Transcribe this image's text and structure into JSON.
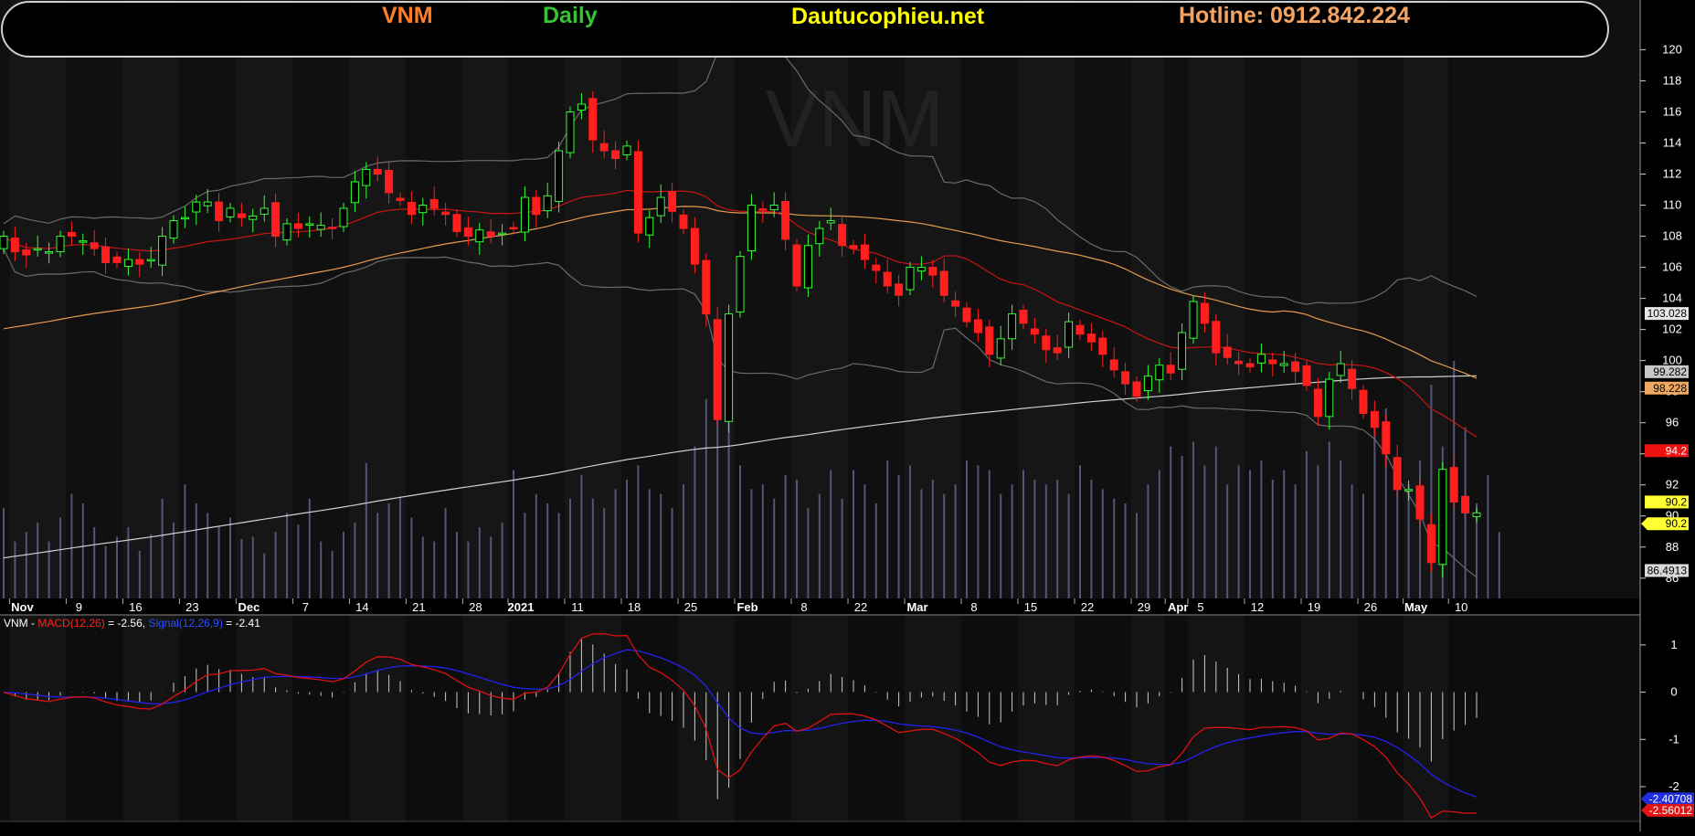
{
  "header": {
    "symbol": "VNM",
    "interval": "Daily",
    "site": "Dautucophieu.net",
    "hotline": "Hotline: 0912.842.224",
    "colors": {
      "symbol": "#ff7f27",
      "interval": "#34c534",
      "site": "#ffff00",
      "hotline": "#f4a460"
    }
  },
  "watermark": "VNM",
  "chart_data": [
    {
      "type": "candlestick",
      "title": "VNM",
      "ylim": [
        84.4,
        121.2
      ],
      "yticks": [
        86,
        88,
        90,
        92,
        94,
        96,
        98,
        100,
        102,
        104,
        106,
        108,
        110,
        112,
        114,
        116,
        118,
        120
      ],
      "date_labels": [
        {
          "i": 1,
          "label": "Nov",
          "major": true
        },
        {
          "i": 6,
          "label": "9",
          "major": false
        },
        {
          "i": 11,
          "label": "16",
          "major": false
        },
        {
          "i": 16,
          "label": "23",
          "major": false
        },
        {
          "i": 21,
          "label": "Dec",
          "major": true
        },
        {
          "i": 26,
          "label": "7",
          "major": false
        },
        {
          "i": 31,
          "label": "14",
          "major": false
        },
        {
          "i": 36,
          "label": "21",
          "major": false
        },
        {
          "i": 41,
          "label": "28",
          "major": false
        },
        {
          "i": 45,
          "label": "2021",
          "major": true
        },
        {
          "i": 50,
          "label": "11",
          "major": false
        },
        {
          "i": 55,
          "label": "18",
          "major": false
        },
        {
          "i": 60,
          "label": "25",
          "major": false
        },
        {
          "i": 65,
          "label": "Feb",
          "major": true
        },
        {
          "i": 70,
          "label": "8",
          "major": false
        },
        {
          "i": 75,
          "label": "22",
          "major": false
        },
        {
          "i": 80,
          "label": "Mar",
          "major": true
        },
        {
          "i": 85,
          "label": "8",
          "major": false
        },
        {
          "i": 90,
          "label": "15",
          "major": false
        },
        {
          "i": 95,
          "label": "22",
          "major": false
        },
        {
          "i": 100,
          "label": "29",
          "major": false
        },
        {
          "i": 103,
          "label": "Apr",
          "major": true
        },
        {
          "i": 105,
          "label": "5",
          "major": false
        },
        {
          "i": 110,
          "label": "12",
          "major": false
        },
        {
          "i": 115,
          "label": "19",
          "major": false
        },
        {
          "i": 120,
          "label": "26",
          "major": false
        },
        {
          "i": 124,
          "label": "May",
          "major": true
        },
        {
          "i": 128,
          "label": "10",
          "major": false
        }
      ],
      "closes": [
        108.0,
        107.0,
        106.8,
        107.2,
        107.0,
        108.0,
        108.0,
        107.7,
        107.2,
        106.3,
        106.3,
        106.5,
        106.2,
        106.5,
        108.0,
        109.0,
        109.2,
        110.2,
        110.2,
        109.0,
        109.8,
        109.2,
        109.3,
        109.8,
        108.0,
        108.8,
        108.5,
        108.8,
        108.7,
        108.5,
        109.8,
        111.5,
        112.3,
        112.0,
        110.8,
        110.3,
        109.4,
        110.0,
        109.8,
        109.4,
        108.3,
        108.0,
        108.4,
        108.0,
        108.2,
        108.5,
        110.5,
        109.4,
        110.6,
        113.5,
        116.0,
        116.5,
        114.2,
        113.5,
        113.0,
        113.8,
        108.2,
        109.2,
        110.5,
        109.6,
        108.5,
        106.2,
        103.0,
        96.2,
        103.0,
        106.7,
        110.0,
        109.7,
        110.0,
        107.8,
        104.8,
        107.4,
        108.5,
        109.0,
        107.4,
        107.2,
        106.5,
        105.8,
        104.8,
        104.2,
        106.0,
        106.0,
        105.5,
        104.2,
        103.5,
        102.5,
        101.8,
        100.4,
        101.4,
        103.0,
        102.4,
        101.7,
        100.7,
        100.5,
        102.5,
        101.7,
        101.2,
        100.4,
        99.4,
        98.5,
        97.7,
        99.0,
        99.7,
        99.2,
        101.8,
        103.8,
        102.4,
        100.5,
        100.2,
        99.8,
        99.6,
        100.4,
        99.8,
        99.8,
        99.3,
        98.4,
        96.4,
        98.8,
        99.8,
        98.2,
        96.6,
        95.7,
        94.0,
        91.7,
        91.7,
        89.8,
        87.0,
        93.0,
        90.9,
        90.2,
        90.2
      ],
      "volume_ylim": [
        0,
        100
      ],
      "volume": [
        38,
        24,
        28,
        32,
        24,
        34,
        44,
        40,
        30,
        22,
        26,
        30,
        20,
        27,
        42,
        32,
        48,
        40,
        36,
        30,
        34,
        25,
        26,
        19,
        28,
        36,
        31,
        42,
        24,
        20,
        28,
        32,
        57,
        36,
        40,
        43,
        34,
        26,
        24,
        38,
        28,
        24,
        30,
        26,
        32,
        54,
        36,
        44,
        40,
        36,
        42,
        52,
        42,
        38,
        46,
        50,
        56,
        46,
        44,
        38,
        48,
        64,
        84,
        100,
        74,
        56,
        46,
        48,
        42,
        52,
        50,
        38,
        44,
        54,
        42,
        54,
        48,
        40,
        58,
        52,
        56,
        46,
        50,
        44,
        48,
        58,
        56,
        54,
        44,
        48,
        54,
        50,
        48,
        50,
        44,
        56,
        50,
        46,
        42,
        40,
        36,
        48,
        54,
        64,
        60,
        66,
        56,
        64,
        48,
        56,
        54,
        58,
        50,
        54,
        48,
        62,
        56,
        66,
        58,
        48,
        44,
        74,
        80,
        56,
        48,
        58,
        90,
        64,
        100,
        72,
        40,
        52,
        28
      ],
      "current_price": 90.2,
      "labels": {
        "white": "103.028",
        "upper": "99.282",
        "orange": "98.228",
        "red": "94.2",
        "yellow1": "90.2",
        "yellow2": "90.2",
        "lower": "86.4913"
      },
      "colors": {
        "up": "#33ff33",
        "down": "#ff1f1f",
        "volume": "#55557a",
        "ma_red": "#c81414",
        "ma_orange": "#e69a4f",
        "ma_white": "#cfcfcf",
        "band": "#6a6a6a"
      }
    },
    {
      "type": "line",
      "title": "VNM - MACD(12,26) = -2.56, Signal(12,26,9) = -2.41",
      "legend": {
        "symbol": "VNM",
        "macd_name": "MACD(12,26)",
        "macd_value": "= -2.56,",
        "signal_name": "Signal(12,26,9)",
        "signal_value": "= -2.41"
      },
      "ylim": [
        -2.6,
        1.5
      ],
      "yticks": [
        -2,
        -1,
        0,
        1
      ],
      "macd_last_label": "-2.56012",
      "signal_last_label": "-2.40708",
      "colors": {
        "macd": "#dd1111",
        "signal": "#2222ee",
        "hist": "#cccccc",
        "legend_macd": "#ff2222",
        "legend_signal": "#2f4fff"
      }
    }
  ]
}
